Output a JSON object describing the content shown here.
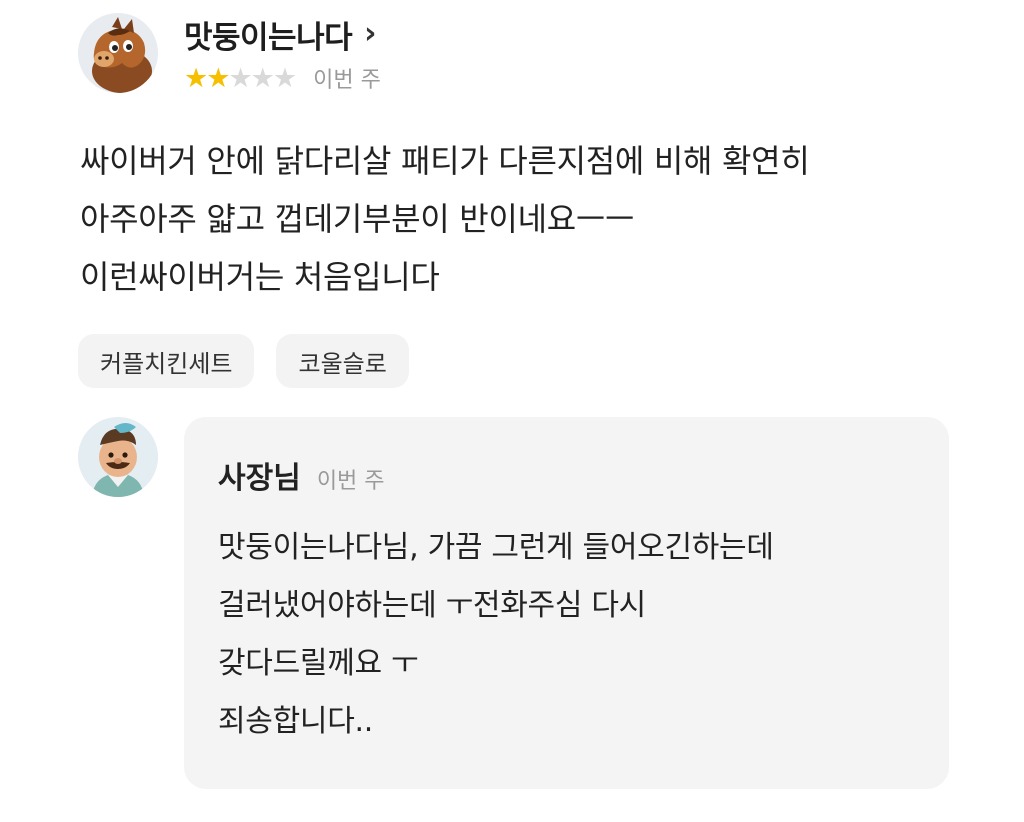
{
  "review": {
    "reviewer_name": "맛둥이는나다",
    "chevron": "›",
    "rating": 2,
    "rating_max": 5,
    "star_glyph": "★",
    "star_color_on": "#f6bf00",
    "star_color_off": "#d9d9d9",
    "time": "이번 주",
    "reviewer_avatar_icon": "horse-character-avatar-icon",
    "lines": [
      "싸이버거 안에 닭다리살 패티가 다른지점에 비해 확연히",
      "아주아주 얇고 껍데기부분이 반이네요ㅡㅡ",
      "이런싸이버거는 처음입니다"
    ],
    "tags": [
      "커플치킨세트",
      "코울슬로"
    ]
  },
  "reply": {
    "owner_name": "사장님",
    "time": "이번 주",
    "owner_avatar_icon": "chef-character-avatar-icon",
    "lines": [
      "맛둥이는나다님, 가끔 그런게 들어오긴하는데",
      "걸러냈어야하는데 ㅜ전화주심 다시",
      "갖다드릴께요 ㅜ",
      "죄송합니다.."
    ]
  }
}
